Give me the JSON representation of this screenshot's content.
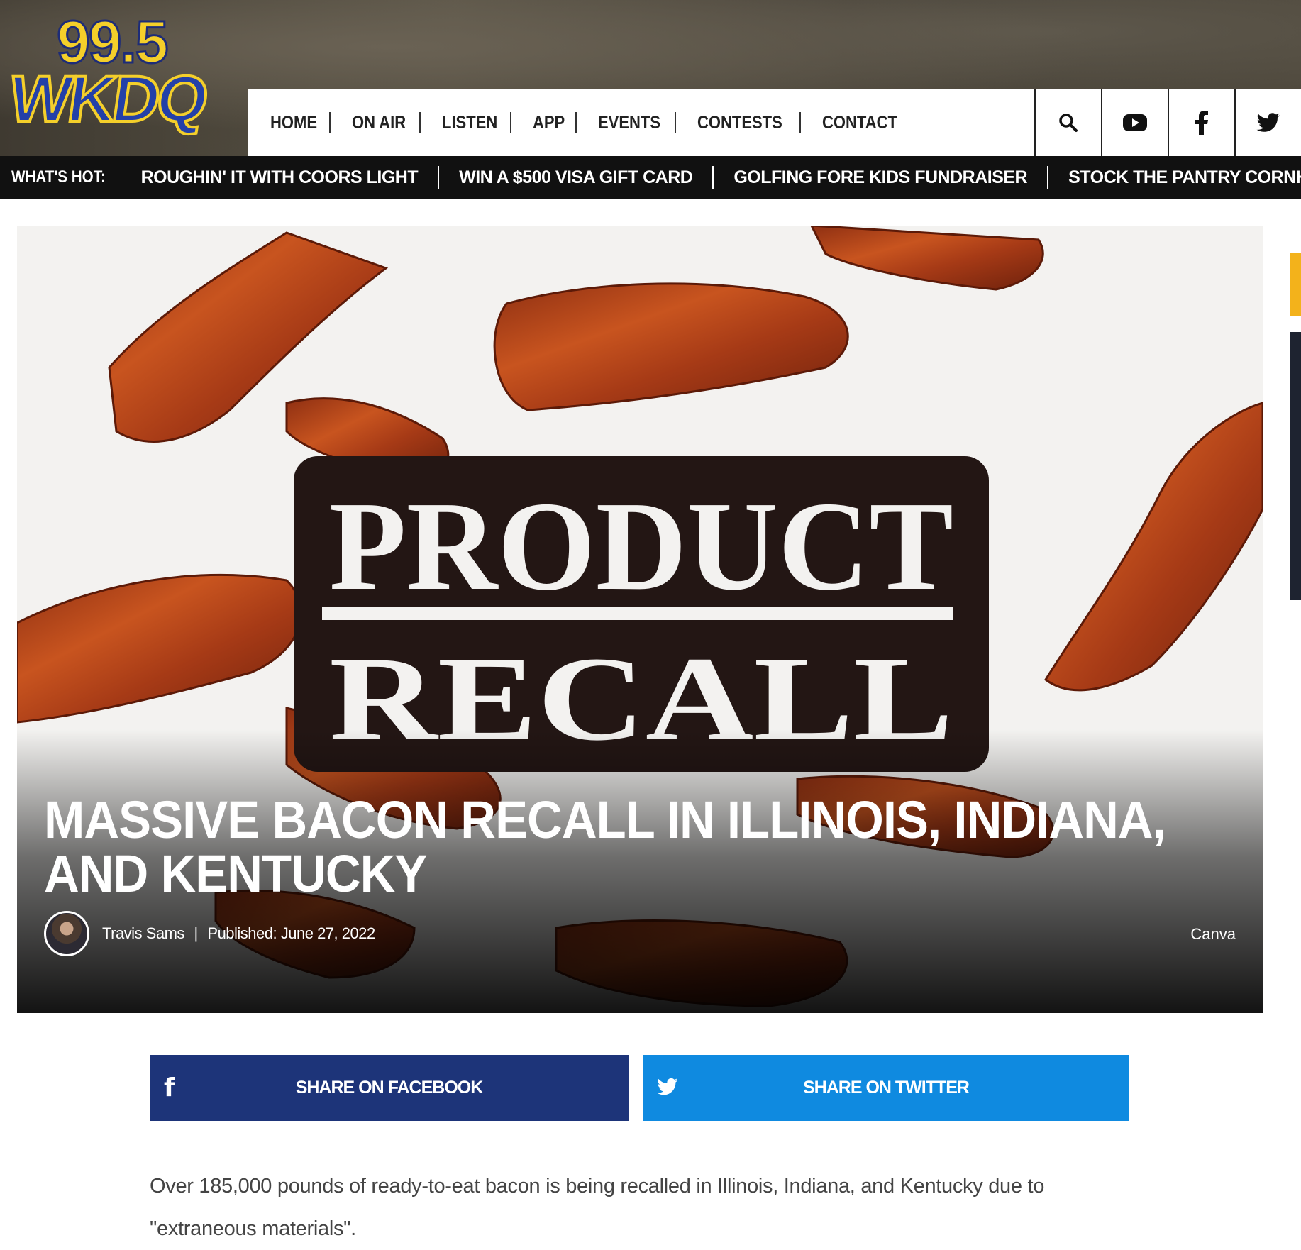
{
  "logo": {
    "frequency": "99.5",
    "callsign": "WKDQ"
  },
  "nav": {
    "items": [
      "HOME",
      "ON AIR",
      "LISTEN",
      "APP",
      "EVENTS",
      "CONTESTS",
      "CONTACT"
    ],
    "icons": [
      "search-icon",
      "youtube-icon",
      "facebook-icon",
      "twitter-icon"
    ]
  },
  "whats_hot": {
    "label": "WHAT'S HOT:",
    "items": [
      "ROUGHIN' IT WITH COORS LIGHT",
      "WIN A $500 VISA GIFT CARD",
      "GOLFING FORE KIDS FUNDRAISER",
      "STOCK THE PANTRY CORNHOLE TOURNEY"
    ]
  },
  "hero": {
    "sign_line1": "PRODUCT",
    "sign_line2": "RECALL",
    "title": "MASSIVE BACON RECALL IN ILLINOIS, INDIANA, AND KENTUCKY",
    "author": "Travis Sams",
    "published_label": "Published:",
    "published_date": "June 27, 2022",
    "credit": "Canva"
  },
  "share": {
    "facebook_label": "SHARE ON FACEBOOK",
    "twitter_label": "SHARE ON TWITTER"
  },
  "article": {
    "paragraph": "Over 185,000 pounds of ready-to-eat bacon is being recalled in Illinois, Indiana, and Kentucky due to \"extraneous materials\"."
  },
  "colors": {
    "facebook": "#1d3479",
    "twitter": "#0f8ae0",
    "logo_yellow": "#f4cf2a",
    "logo_blue": "#2340a8"
  }
}
